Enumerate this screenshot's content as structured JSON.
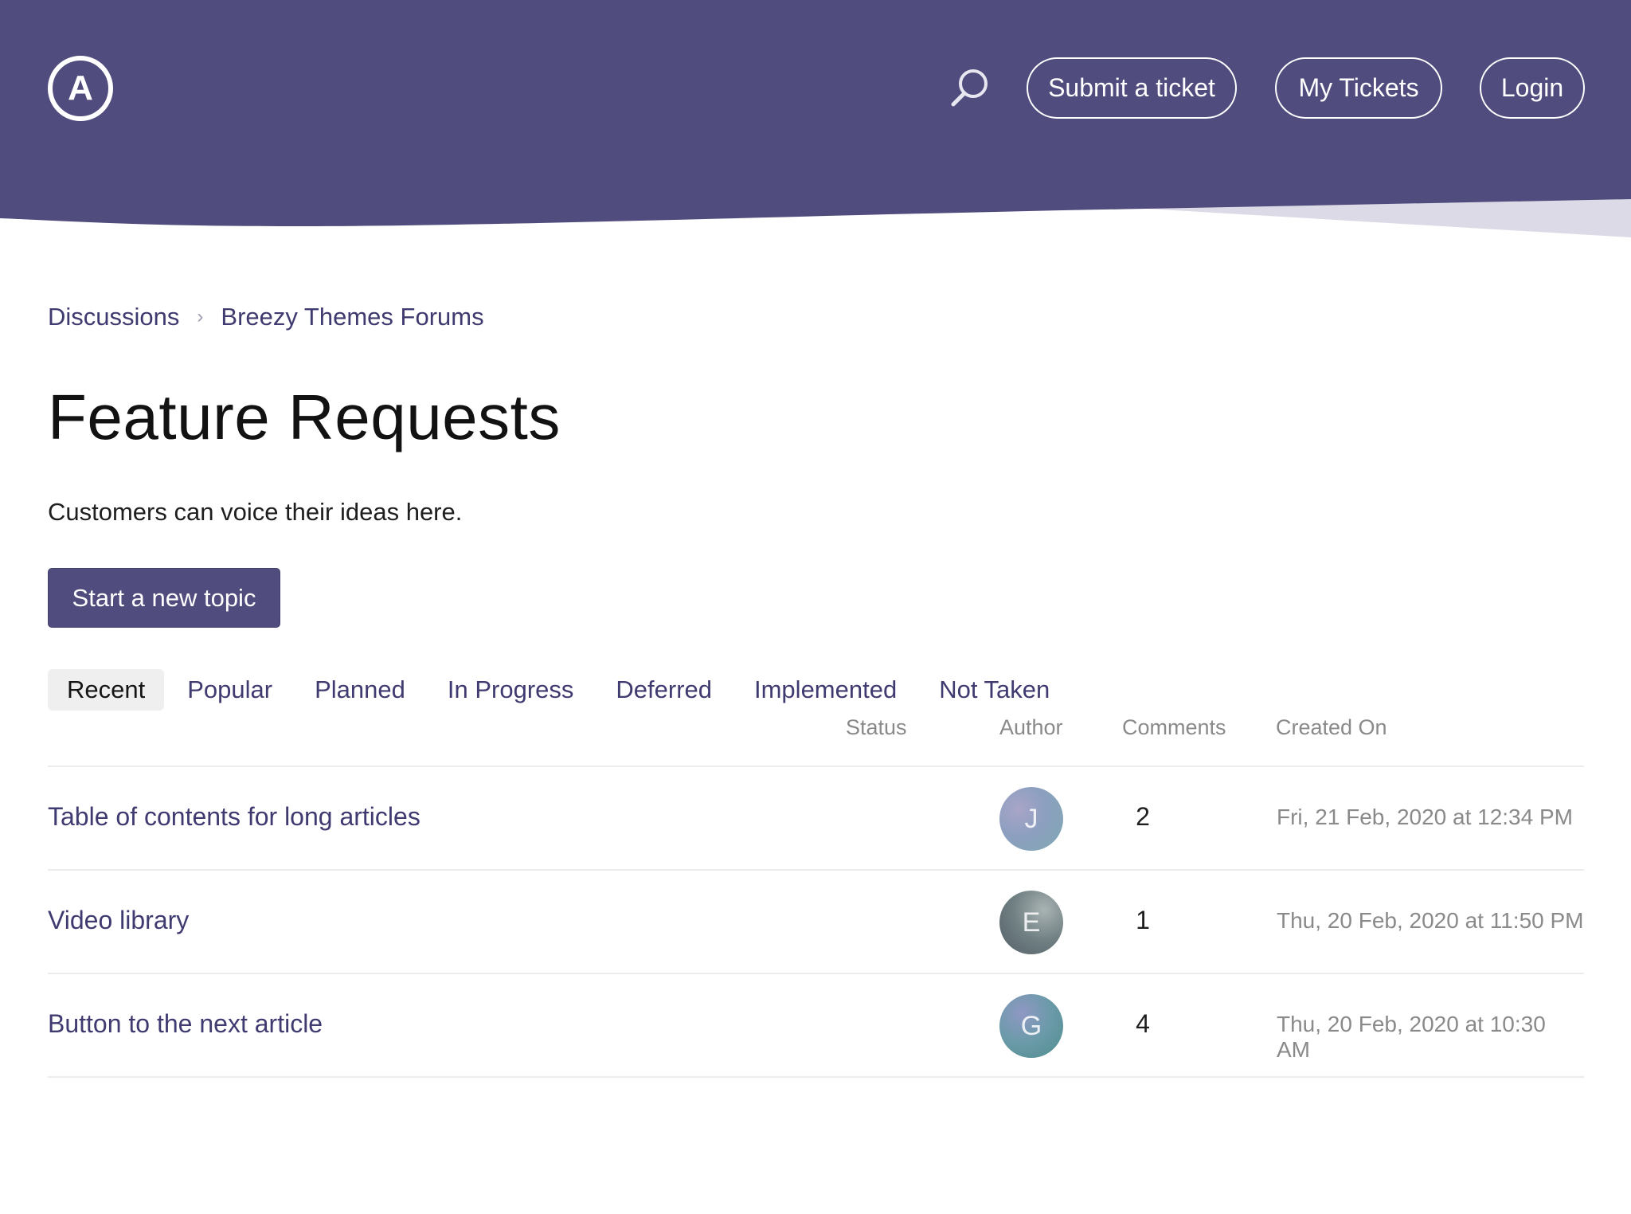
{
  "header": {
    "logo_letter": "A",
    "nav": {
      "submit_ticket": "Submit a ticket",
      "my_tickets": "My Tickets",
      "login": "Login"
    },
    "brand_color": "#504c7d"
  },
  "breadcrumb": [
    "Discussions",
    "Breezy Themes Forums"
  ],
  "page": {
    "title": "Feature Requests",
    "description": "Customers can voice their ideas here.",
    "new_topic_label": "Start a new topic"
  },
  "tabs": [
    {
      "label": "Recent",
      "active": true
    },
    {
      "label": "Popular",
      "active": false
    },
    {
      "label": "Planned",
      "active": false
    },
    {
      "label": "In Progress",
      "active": false
    },
    {
      "label": "Deferred",
      "active": false
    },
    {
      "label": "Implemented",
      "active": false
    },
    {
      "label": "Not Taken",
      "active": false
    }
  ],
  "columns": {
    "status": "Status",
    "author": "Author",
    "comments": "Comments",
    "created_on": "Created On"
  },
  "topics": [
    {
      "title": "Table of contents for long articles",
      "author_initial": "J",
      "comments": "2",
      "created_on": "Fri, 21 Feb, 2020 at 12:34 PM"
    },
    {
      "title": "Video library",
      "author_initial": "E",
      "comments": "1",
      "created_on": "Thu, 20 Feb, 2020 at 11:50 PM"
    },
    {
      "title": "Button to the next article",
      "author_initial": "G",
      "comments": "4",
      "created_on": "Thu, 20 Feb, 2020 at 10:30 AM"
    }
  ]
}
